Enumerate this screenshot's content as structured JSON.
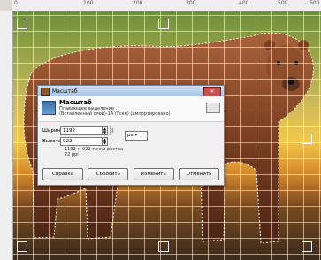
{
  "ruler": {
    "labels": [
      "0",
      "100",
      "200",
      "300",
      "400",
      "500",
      "600"
    ]
  },
  "dialog": {
    "window_title": "Масштаб",
    "close_label": "✕",
    "header": {
      "title": "Масштаб",
      "subtitle1": "Плавающее выделение",
      "subtitle2": "(Вставленный слой)-1А (Ускн) (импортировано)"
    },
    "width_label": "Ширина:",
    "width_value": "1192",
    "height_label": "Высота:",
    "height_value": "922",
    "unit": "px",
    "info_size": "1192 × 922 точки растра",
    "info_dpi": "72 ppi",
    "buttons": {
      "help": "Справка",
      "reset": "Сбросить",
      "scale": "Изменить",
      "cancel": "Отменить"
    }
  },
  "colors": {
    "selection": "#ffffff",
    "titlebar": "#a9c3e3",
    "close": "#c75050"
  },
  "icons": [
    "gimp-scale-icon",
    "chain-icon",
    "close-icon",
    "spin-up-icon",
    "spin-down-icon",
    "dropdown-icon"
  ]
}
